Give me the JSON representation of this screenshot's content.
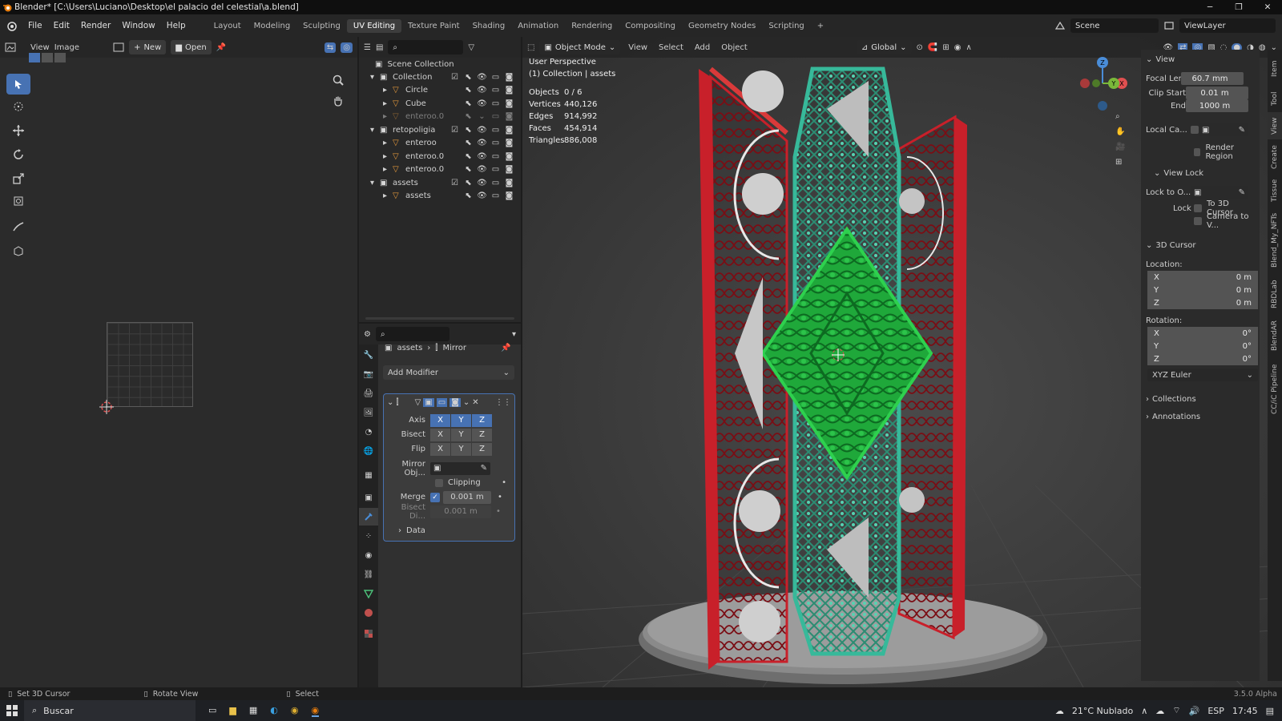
{
  "window": {
    "title": "Blender* [C:\\Users\\Luciano\\Desktop\\el palacio del celestial\\a.blend]"
  },
  "menu": {
    "items": [
      "File",
      "Edit",
      "Render",
      "Window",
      "Help"
    ]
  },
  "workspaces": [
    "Layout",
    "Modeling",
    "Sculpting",
    "UV Editing",
    "Texture Paint",
    "Shading",
    "Animation",
    "Rendering",
    "Compositing",
    "Geometry Nodes",
    "Scripting"
  ],
  "scene": {
    "label": "Scene",
    "viewlayer": "ViewLayer"
  },
  "image_editor": {
    "view": "View",
    "image": "Image",
    "new_label": "New",
    "open_label": "Open"
  },
  "outliner": {
    "root": "Scene Collection",
    "rows": [
      {
        "name": "Collection",
        "depth": 1,
        "type": "collection",
        "dim": false
      },
      {
        "name": "Circle",
        "depth": 2,
        "type": "mesh",
        "dim": false
      },
      {
        "name": "Cube",
        "depth": 2,
        "type": "mesh",
        "dim": false
      },
      {
        "name": "enteroo.0",
        "depth": 2,
        "type": "mesh",
        "dim": true
      },
      {
        "name": "retopoligia",
        "depth": 1,
        "type": "collection",
        "dim": false
      },
      {
        "name": "enteroo",
        "depth": 2,
        "type": "mesh",
        "dim": false
      },
      {
        "name": "enteroo.0",
        "depth": 2,
        "type": "mesh",
        "dim": false
      },
      {
        "name": "enteroo.0",
        "depth": 2,
        "type": "mesh",
        "dim": false
      },
      {
        "name": "assets",
        "depth": 1,
        "type": "collection",
        "dim": false
      },
      {
        "name": "assets",
        "depth": 2,
        "type": "mesh",
        "dim": false
      }
    ]
  },
  "properties": {
    "breadcrumb": {
      "object": "assets",
      "modifier": "Mirror"
    },
    "add_modifier": "Add Modifier",
    "axis_label": "Axis",
    "bisect_label": "Bisect",
    "flip_label": "Flip",
    "axes": [
      "X",
      "Y",
      "Z"
    ],
    "axis_on": [
      true,
      true,
      true
    ],
    "mirror_obj_label": "Mirror Obj...",
    "clipping_label": "Clipping",
    "merge_label": "Merge",
    "merge_value": "0.001 m",
    "bisect_dist_label": "Bisect Di...",
    "bisect_dist_value": "0.001 m",
    "data_label": "Data"
  },
  "viewport": {
    "mode": "Object Mode",
    "menu": [
      "View",
      "Select",
      "Add",
      "Object"
    ],
    "transform": "Global",
    "overlay_title": "User Perspective",
    "overlay_sub": "(1) Collection | assets",
    "stats": [
      {
        "k": "Objects",
        "v": "0 / 6"
      },
      {
        "k": "Vertices",
        "v": "440,126"
      },
      {
        "k": "Edges",
        "v": "914,992"
      },
      {
        "k": "Faces",
        "v": "454,914"
      },
      {
        "k": "Triangles",
        "v": "886,008"
      }
    ]
  },
  "npanel": {
    "view_title": "View",
    "focal_label": "Focal Length",
    "focal_value": "60.7 mm",
    "clip_start_label": "Clip Start",
    "clip_start_value": "0.01 m",
    "end_label": "End",
    "end_value": "1000 m",
    "local_cam_label": "Local Ca...",
    "render_region_label": "Render Region",
    "view_lock_title": "View Lock",
    "lock_to_label": "Lock to O...",
    "lock_label": "Lock",
    "to_cursor_label": "To 3D Cursor",
    "camera_to_view_label": "Camera to V...",
    "cursor_title": "3D Cursor",
    "location_label": "Location:",
    "loc": [
      {
        "axis": "X",
        "v": "0 m"
      },
      {
        "axis": "Y",
        "v": "0 m"
      },
      {
        "axis": "Z",
        "v": "0 m"
      }
    ],
    "rotation_label": "Rotation:",
    "rot": [
      {
        "axis": "X",
        "v": "0°"
      },
      {
        "axis": "Y",
        "v": "0°"
      },
      {
        "axis": "Z",
        "v": "0°"
      }
    ],
    "euler": "XYZ Euler",
    "collections_label": "Collections",
    "annotations_label": "Annotations"
  },
  "side_tabs": [
    "Item",
    "Tool",
    "View",
    "Create",
    "Tissue",
    "Blend_My_NFTs",
    "RBDLab",
    "BlendAR",
    "CC/iC Pipeline"
  ],
  "status": {
    "left": "Set 3D Cursor",
    "mid": "Rotate View",
    "right": "Select",
    "version": "3.5.0 Alpha"
  },
  "taskbar": {
    "search": "Buscar",
    "weather": "21°C  Nublado",
    "lang": "ESP",
    "time": "17:45"
  },
  "colors": {
    "accent": "#4772b3",
    "red_frame": "#c8202a",
    "green_core": "#1fa83a",
    "teal_lattice": "#37b99a"
  }
}
